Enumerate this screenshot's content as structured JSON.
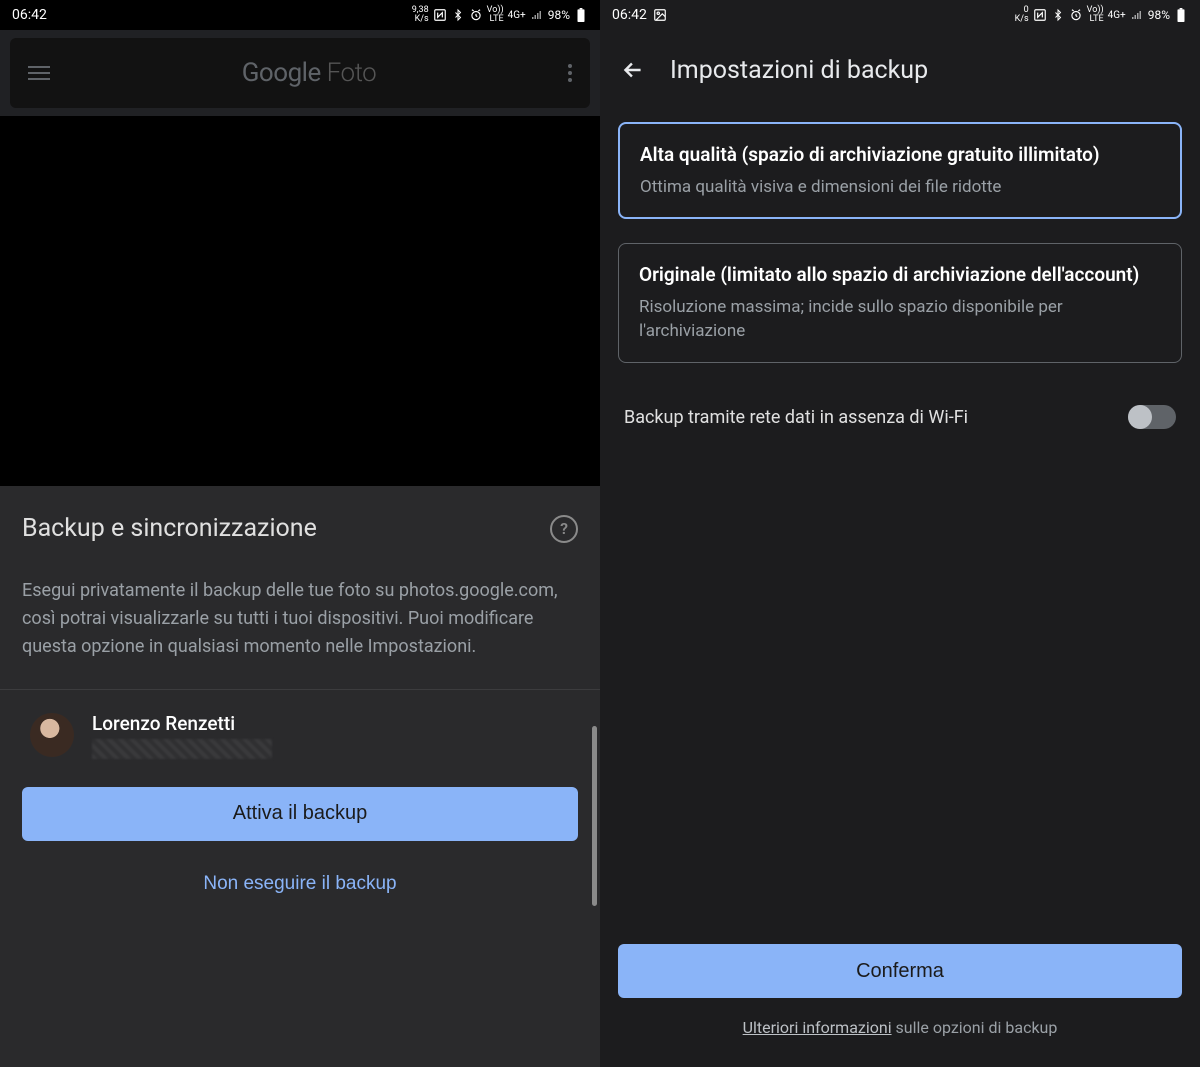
{
  "status": {
    "time_left": "06:42",
    "time_right": "06:42",
    "kps_left_top": "9,38",
    "kps_left_bot": "K/s",
    "kps_right_top": "0",
    "kps_right_bot": "K/s",
    "lte": "LTE",
    "vol": "Vo))",
    "net": "4G+",
    "battery": "98%",
    "gallery_icon": "gallery-icon"
  },
  "left": {
    "app_title_google": "Google",
    "app_title_foto": " Foto",
    "sheet_title": "Backup e sincronizzazione",
    "sheet_desc": "Esegui privatamente il backup delle tue foto su photos.google.com, così potrai visualizzarle su tutti i tuoi dispositivi. Puoi modificare questa opzione in qualsiasi momento nelle Impostazioni.",
    "account_name": "Lorenzo Renzetti",
    "btn_enable": "Attiva il backup",
    "btn_skip": "Non eseguire il backup",
    "help_q": "?"
  },
  "right": {
    "title": "Impostazioni di backup",
    "option1_title": "Alta qualità (spazio di archiviazione gratuito illimitato)",
    "option1_desc": "Ottima qualità visiva e dimensioni dei file ridotte",
    "option2_title": "Originale (limitato allo spazio di archiviazione dell'account)",
    "option2_desc": "Risoluzione massima; incide sullo spazio disponibile per l'archiviazione",
    "toggle_label": "Backup tramite rete dati in assenza di Wi-Fi",
    "btn_confirm": "Conferma",
    "more_info_ul": "Ulteriori informazioni",
    "more_info_rest": " sulle opzioni di backup"
  }
}
